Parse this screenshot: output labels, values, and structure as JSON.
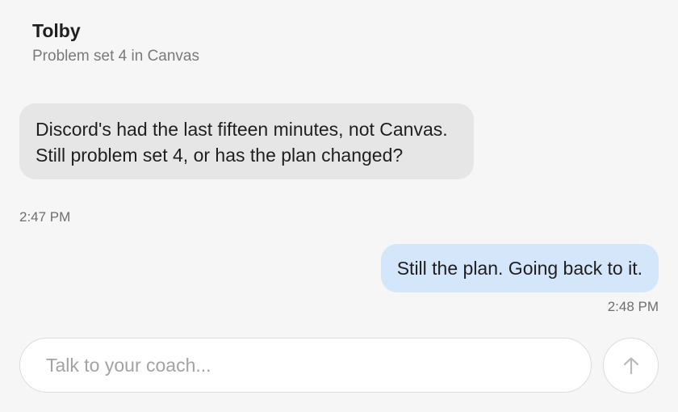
{
  "header": {
    "title": "Tolby",
    "subtitle": "Problem set 4 in Canvas"
  },
  "messages": [
    {
      "sender": "coach",
      "text": "Discord's had the last fifteen minutes, not Canvas. Still problem set 4, or has the plan changed?",
      "time": "2:47 PM"
    },
    {
      "sender": "user",
      "text": "Still the plan. Going back to it.",
      "time": "2:48 PM"
    }
  ],
  "composer": {
    "placeholder": "Talk to your coach...",
    "value": "",
    "send_icon": "arrow-up-icon"
  },
  "colors": {
    "background": "#f6f6f6",
    "incoming_bubble": "#e6e6e6",
    "outgoing_bubble": "#d4e6fa"
  }
}
